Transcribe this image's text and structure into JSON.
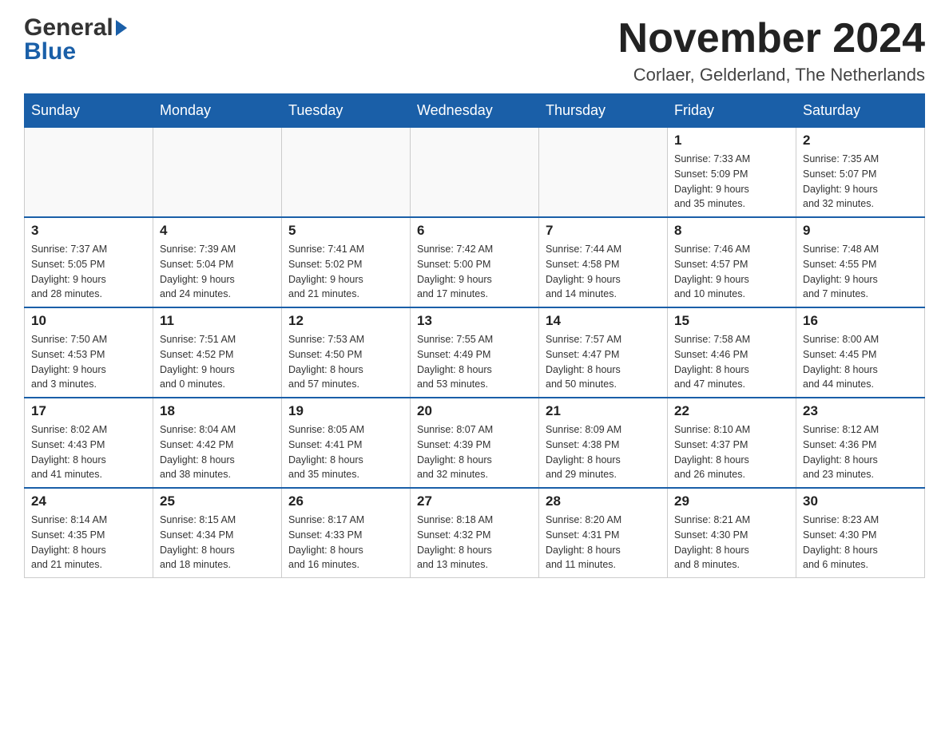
{
  "header": {
    "logo_general": "General",
    "logo_arrow": "▶",
    "logo_blue": "Blue",
    "main_title": "November 2024",
    "subtitle": "Corlaer, Gelderland, The Netherlands"
  },
  "days_of_week": [
    "Sunday",
    "Monday",
    "Tuesday",
    "Wednesday",
    "Thursday",
    "Friday",
    "Saturday"
  ],
  "weeks": [
    {
      "days": [
        {
          "number": "",
          "info": ""
        },
        {
          "number": "",
          "info": ""
        },
        {
          "number": "",
          "info": ""
        },
        {
          "number": "",
          "info": ""
        },
        {
          "number": "",
          "info": ""
        },
        {
          "number": "1",
          "info": "Sunrise: 7:33 AM\nSunset: 5:09 PM\nDaylight: 9 hours\nand 35 minutes."
        },
        {
          "number": "2",
          "info": "Sunrise: 7:35 AM\nSunset: 5:07 PM\nDaylight: 9 hours\nand 32 minutes."
        }
      ]
    },
    {
      "days": [
        {
          "number": "3",
          "info": "Sunrise: 7:37 AM\nSunset: 5:05 PM\nDaylight: 9 hours\nand 28 minutes."
        },
        {
          "number": "4",
          "info": "Sunrise: 7:39 AM\nSunset: 5:04 PM\nDaylight: 9 hours\nand 24 minutes."
        },
        {
          "number": "5",
          "info": "Sunrise: 7:41 AM\nSunset: 5:02 PM\nDaylight: 9 hours\nand 21 minutes."
        },
        {
          "number": "6",
          "info": "Sunrise: 7:42 AM\nSunset: 5:00 PM\nDaylight: 9 hours\nand 17 minutes."
        },
        {
          "number": "7",
          "info": "Sunrise: 7:44 AM\nSunset: 4:58 PM\nDaylight: 9 hours\nand 14 minutes."
        },
        {
          "number": "8",
          "info": "Sunrise: 7:46 AM\nSunset: 4:57 PM\nDaylight: 9 hours\nand 10 minutes."
        },
        {
          "number": "9",
          "info": "Sunrise: 7:48 AM\nSunset: 4:55 PM\nDaylight: 9 hours\nand 7 minutes."
        }
      ]
    },
    {
      "days": [
        {
          "number": "10",
          "info": "Sunrise: 7:50 AM\nSunset: 4:53 PM\nDaylight: 9 hours\nand 3 minutes."
        },
        {
          "number": "11",
          "info": "Sunrise: 7:51 AM\nSunset: 4:52 PM\nDaylight: 9 hours\nand 0 minutes."
        },
        {
          "number": "12",
          "info": "Sunrise: 7:53 AM\nSunset: 4:50 PM\nDaylight: 8 hours\nand 57 minutes."
        },
        {
          "number": "13",
          "info": "Sunrise: 7:55 AM\nSunset: 4:49 PM\nDaylight: 8 hours\nand 53 minutes."
        },
        {
          "number": "14",
          "info": "Sunrise: 7:57 AM\nSunset: 4:47 PM\nDaylight: 8 hours\nand 50 minutes."
        },
        {
          "number": "15",
          "info": "Sunrise: 7:58 AM\nSunset: 4:46 PM\nDaylight: 8 hours\nand 47 minutes."
        },
        {
          "number": "16",
          "info": "Sunrise: 8:00 AM\nSunset: 4:45 PM\nDaylight: 8 hours\nand 44 minutes."
        }
      ]
    },
    {
      "days": [
        {
          "number": "17",
          "info": "Sunrise: 8:02 AM\nSunset: 4:43 PM\nDaylight: 8 hours\nand 41 minutes."
        },
        {
          "number": "18",
          "info": "Sunrise: 8:04 AM\nSunset: 4:42 PM\nDaylight: 8 hours\nand 38 minutes."
        },
        {
          "number": "19",
          "info": "Sunrise: 8:05 AM\nSunset: 4:41 PM\nDaylight: 8 hours\nand 35 minutes."
        },
        {
          "number": "20",
          "info": "Sunrise: 8:07 AM\nSunset: 4:39 PM\nDaylight: 8 hours\nand 32 minutes."
        },
        {
          "number": "21",
          "info": "Sunrise: 8:09 AM\nSunset: 4:38 PM\nDaylight: 8 hours\nand 29 minutes."
        },
        {
          "number": "22",
          "info": "Sunrise: 8:10 AM\nSunset: 4:37 PM\nDaylight: 8 hours\nand 26 minutes."
        },
        {
          "number": "23",
          "info": "Sunrise: 8:12 AM\nSunset: 4:36 PM\nDaylight: 8 hours\nand 23 minutes."
        }
      ]
    },
    {
      "days": [
        {
          "number": "24",
          "info": "Sunrise: 8:14 AM\nSunset: 4:35 PM\nDaylight: 8 hours\nand 21 minutes."
        },
        {
          "number": "25",
          "info": "Sunrise: 8:15 AM\nSunset: 4:34 PM\nDaylight: 8 hours\nand 18 minutes."
        },
        {
          "number": "26",
          "info": "Sunrise: 8:17 AM\nSunset: 4:33 PM\nDaylight: 8 hours\nand 16 minutes."
        },
        {
          "number": "27",
          "info": "Sunrise: 8:18 AM\nSunset: 4:32 PM\nDaylight: 8 hours\nand 13 minutes."
        },
        {
          "number": "28",
          "info": "Sunrise: 8:20 AM\nSunset: 4:31 PM\nDaylight: 8 hours\nand 11 minutes."
        },
        {
          "number": "29",
          "info": "Sunrise: 8:21 AM\nSunset: 4:30 PM\nDaylight: 8 hours\nand 8 minutes."
        },
        {
          "number": "30",
          "info": "Sunrise: 8:23 AM\nSunset: 4:30 PM\nDaylight: 8 hours\nand 6 minutes."
        }
      ]
    }
  ]
}
